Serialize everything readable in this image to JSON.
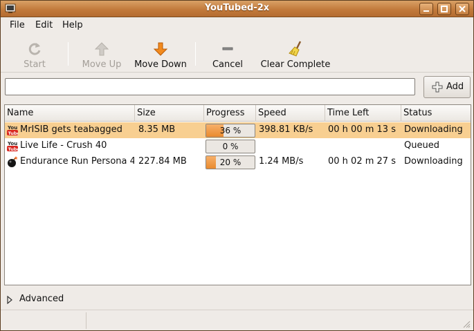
{
  "window": {
    "title": "YouTubed-2x"
  },
  "menu": {
    "file": "File",
    "edit": "Edit",
    "help": "Help"
  },
  "toolbar": {
    "start": "Start",
    "move_up": "Move Up",
    "move_down": "Move Down",
    "cancel": "Cancel",
    "clear_complete": "Clear Complete"
  },
  "url_input": {
    "value": ""
  },
  "add_button": {
    "label": "Add"
  },
  "columns": [
    "Name",
    "Size",
    "Progress",
    "Speed",
    "Time Left",
    "Status"
  ],
  "rows": [
    {
      "icon": "youtube-icon",
      "name": "MrISIB gets teabagged",
      "size": "8.35 MB",
      "progress": 36,
      "progress_text": "36 %",
      "speed": "398.81 KB/s",
      "time_left": "00 h 00 m 13 s",
      "status": "Downloading",
      "selected": true
    },
    {
      "icon": "youtube-icon",
      "name": "Live Life - Crush 40",
      "size": "",
      "progress": 0,
      "progress_text": "0 %",
      "speed": "",
      "time_left": "",
      "status": "Queued",
      "selected": false
    },
    {
      "icon": "bomb-icon",
      "name": "Endurance Run Persona 4",
      "size": "227.84 MB",
      "progress": 20,
      "progress_text": "20 %",
      "speed": "1.24 MB/s",
      "time_left": "00 h 02 m 27 s",
      "status": "Downloading",
      "selected": false
    }
  ],
  "advanced": {
    "label": "Advanced"
  },
  "colors": {
    "titlebar": "#c27a3c",
    "selection": "#f8cf91",
    "progress_fill": "#e98a2e"
  }
}
